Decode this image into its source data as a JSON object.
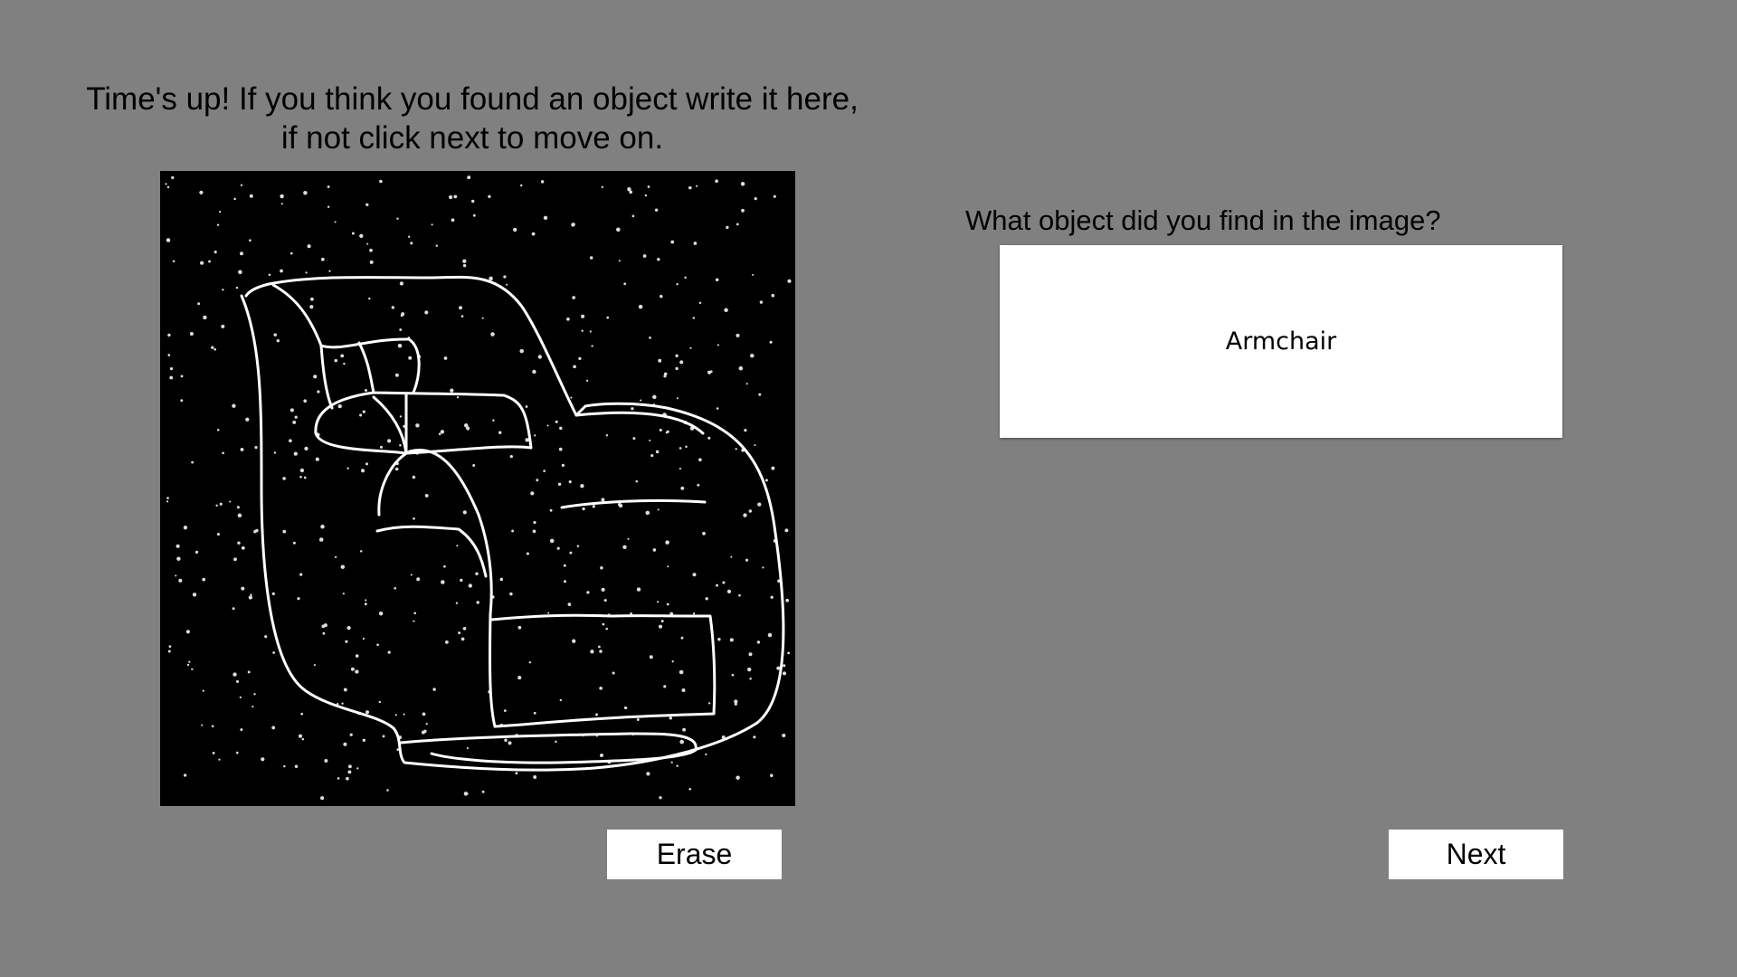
{
  "prompt": {
    "line1": "Time's up! If you think you found an object write it here,",
    "line2": "if not click next to move on."
  },
  "drawing_canvas": {
    "background": "#000000",
    "stroke_color": "#ffffff",
    "dot_color": "#dddddd"
  },
  "question": {
    "label": "What object did you find in the image?",
    "answer": "Armchair"
  },
  "buttons": {
    "erase": "Erase",
    "next": "Next"
  },
  "colors": {
    "page_background": "#808080",
    "panel_background": "#ffffff"
  }
}
